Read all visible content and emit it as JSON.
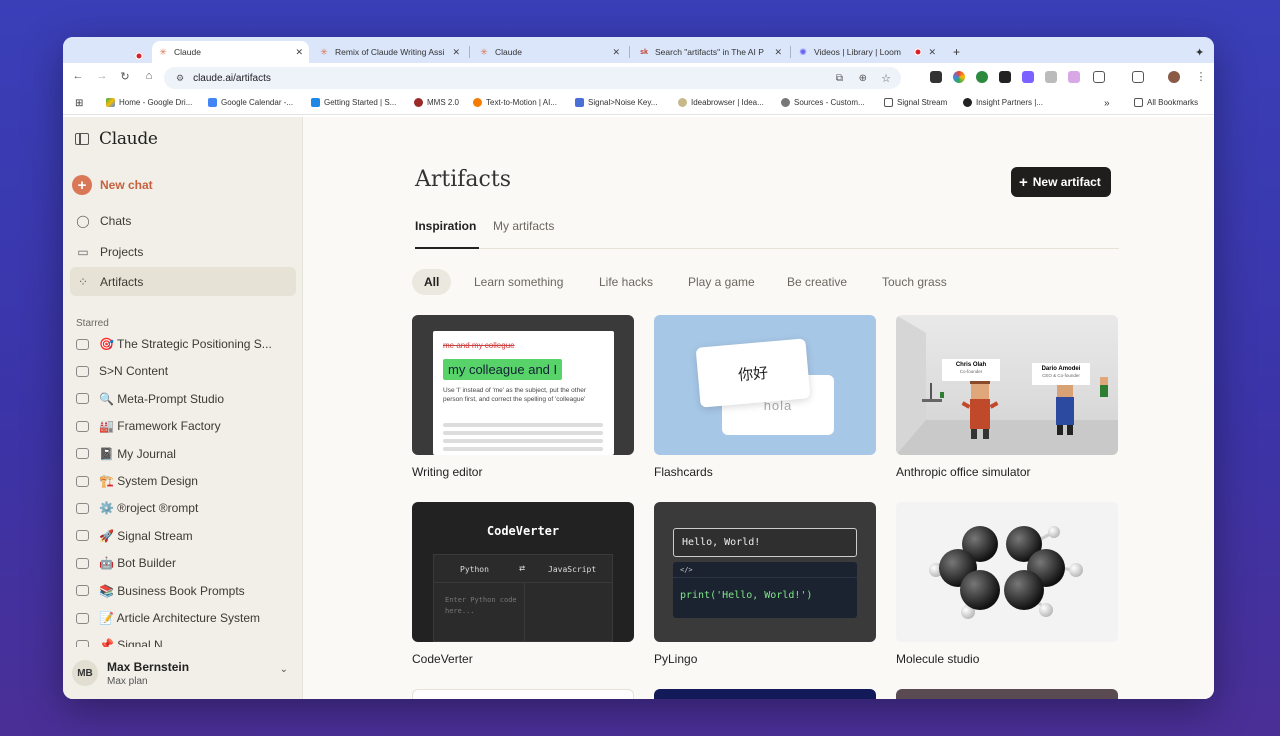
{
  "browser": {
    "tabs": [
      {
        "title": "Claude",
        "active": true
      },
      {
        "title": "Remix of Claude Writing Assi"
      },
      {
        "title": "Claude"
      },
      {
        "title": "Search \"artifacts\" in The AI P"
      },
      {
        "title": "Videos | Library | Loom"
      }
    ],
    "new_tab": "+",
    "url": "claude.ai/artifacts",
    "bookmarks": [
      "Home - Google Dri...",
      "Google Calendar -...",
      "Getting Started | S...",
      "MMS 2.0",
      "Text-to-Motion | AI...",
      "Signal>Noise Key...",
      "Ideabrowser | Idea...",
      "Sources - Custom...",
      "Signal Stream",
      "Insight Partners |..."
    ],
    "more": "»",
    "all_bookmarks": "All Bookmarks"
  },
  "sidebar": {
    "logo": "Claude",
    "new_chat": "New chat",
    "nav": [
      "Chats",
      "Projects",
      "Artifacts"
    ],
    "starred_header": "Starred",
    "starred": [
      "🎯 The Strategic Positioning S...",
      "S>N Content",
      "🔍 Meta-Prompt Studio",
      "🏭 Framework Factory",
      "📓 My Journal",
      "🏗️ System Design",
      "⚙️ ®roject ®rompt",
      "🚀 Signal Stream",
      "🤖 Bot Builder",
      "📚 Business Book Prompts",
      "📝 Article Architecture System",
      "📌 Signal N..."
    ],
    "user": {
      "initials": "MB",
      "name": "Max Bernstein",
      "plan": "Max plan"
    }
  },
  "main": {
    "title": "Artifacts",
    "new_artifact": "New artifact",
    "tabs": [
      "Inspiration",
      "My artifacts"
    ],
    "filters": [
      "All",
      "Learn something",
      "Life hacks",
      "Play a game",
      "Be creative",
      "Touch grass"
    ],
    "cards": [
      {
        "caption": "Writing editor"
      },
      {
        "caption": "Flashcards"
      },
      {
        "caption": "Anthropic office simulator"
      },
      {
        "caption": "CodeVerter"
      },
      {
        "caption": "PyLingo"
      },
      {
        "caption": "Molecule studio"
      }
    ],
    "writing_editor": {
      "strike": "me and my collegue",
      "highlight": "my colleague and I",
      "hint": "Use 'I' instead of 'me' as the subject, put the other person first, and correct the spelling of 'colleague'"
    },
    "flashcards": {
      "front": "你好",
      "back": "hola"
    },
    "office": {
      "p1_name": "Chris Olah",
      "p1_role": "Co-founder",
      "p2_name": "Dario Amodei",
      "p2_role": "CEO & Co-founder"
    },
    "codeverter": {
      "title": "CodeVerter",
      "from": "Python",
      "swap": "⇄",
      "to": "JavaScript",
      "placeholder": "Enter Python code here..."
    },
    "pylingo": {
      "output": "Hello, World!",
      "tag": "</>",
      "code": "print('Hello, World!')"
    }
  },
  "colors": {
    "accent": "#d97757",
    "new_artifact_bg": "#1f1e1d",
    "sidebar_bg": "#f1efe8",
    "main_bg": "#faf9f5"
  }
}
